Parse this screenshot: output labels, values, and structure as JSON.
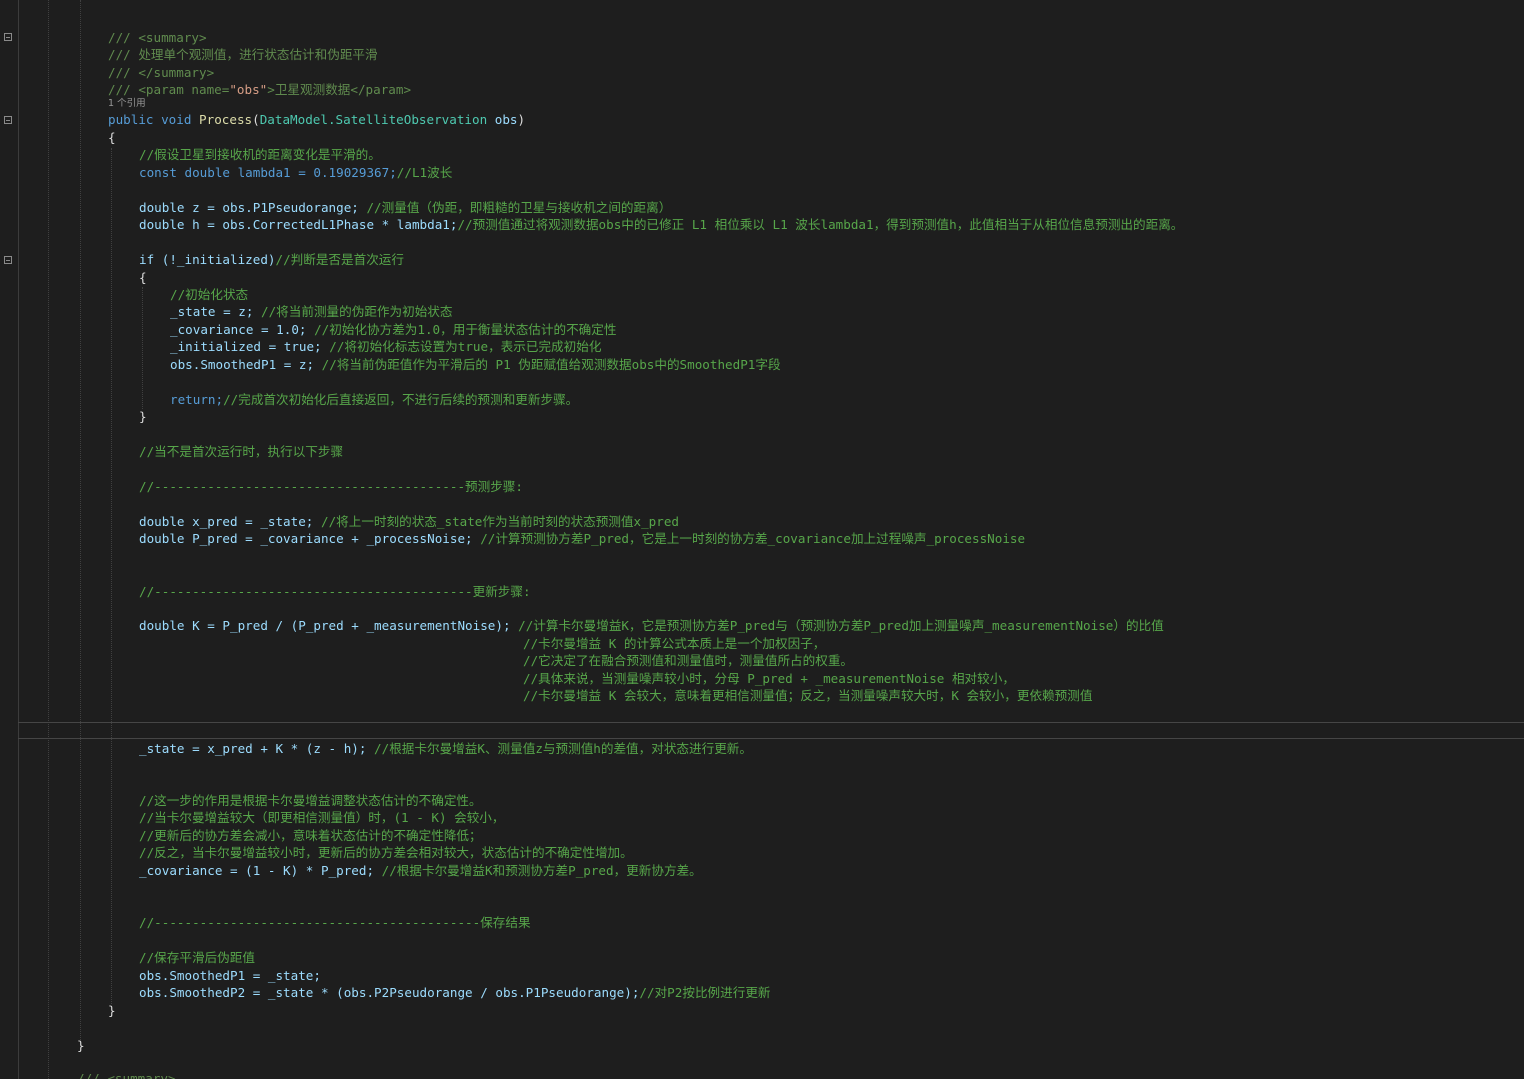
{
  "editor": {
    "lines": {
      "doc_summary_open": "/// <summary>",
      "doc_desc": "/// 处理单个观测值，进行状态估计和伪距平滑",
      "doc_summary_close": "/// </summary>",
      "doc_param_prefix": "/// <param name=",
      "doc_param_name": "\"obs\"",
      "doc_param_text": ">卫星观测数据</param>",
      "ref_count": "1 个引用",
      "sig_public": "public",
      "sig_void": "void",
      "sig_name": "Process",
      "sig_type": "DataModel.SatelliteObservation",
      "sig_param": "obs",
      "l_brace_open": "{",
      "c_assume": "//假设卫星到接收机的距离变化是平滑的。",
      "const_decl": "const double lambda1 = 0.19029367;",
      "const_comment": "//L1波长",
      "z_decl": "double z = obs.P1Pseudorange; ",
      "z_comment": "//测量值（伪距，即粗糙的卫星与接收机之间的距离）",
      "h_decl": "double h = obs.CorrectedL1Phase * lambda1;",
      "h_comment": "//预测值通过将观测数据obs中的已修正 L1 相位乘以 L1 波长lambda1，得到预测值h，此值相当于从相位信息预测出的距离。",
      "if_code": "if (!_initialized)",
      "if_comment": "//判断是否是首次运行",
      "if_brace_open": "{",
      "init_comment": "//初始化状态",
      "state_code": "_state = z; ",
      "state_comment": "//将当前测量的伪距作为初始状态",
      "cov_code": "_covariance = 1.0; ",
      "cov_comment": "//初始化协方差为1.0，用于衡量状态估计的不确定性",
      "init_code": "_initialized = true; ",
      "init_flag_comment": "//将初始化标志设置为true，表示已完成初始化",
      "smooth_code": "obs.SmoothedP1 = z; ",
      "smooth_comment": "//将当前伪距值作为平滑后的 P1 伪距赋值给观测数据obs中的SmoothedP1字段",
      "return_code": "return;",
      "return_comment": "//完成首次初始化后直接返回，不进行后续的预测和更新步骤。",
      "if_brace_close": "}",
      "not_first_comment": "//当不是首次运行时，执行以下步骤",
      "predict_sep": "//-----------------------------------------预测步骤:",
      "xpred_code": "double x_pred = _state; ",
      "xpred_comment": "//将上一时刻的状态_state作为当前时刻的状态预测值x_pred",
      "ppred_code": "double P_pred = _covariance + _processNoise; ",
      "ppred_comment": "//计算预测协方差P_pred，它是上一时刻的协方差_covariance加上过程噪声_processNoise",
      "update_sep": "//------------------------------------------更新步骤:",
      "k_code": "double K = P_pred / (P_pred + _measurementNoise); ",
      "k_comment1": "//计算卡尔曼增益K，它是预测协方差P_pred与（预测协方差P_pred加上测量噪声_measurementNoise）的比值",
      "k_comment2": "//卡尔曼增益 K 的计算公式本质上是一个加权因子，",
      "k_comment3": "//它决定了在融合预测值和测量值时，测量值所占的权重。",
      "k_comment4": "//具体来说，当测量噪声较小时，分母 P_pred + _measurementNoise 相对较小，",
      "k_comment5": "//卡尔曼增益 K 会较大，意味着更相信测量值；反之，当测量噪声较大时，K 会较小，更依赖预测值",
      "state_update_code": "_state = x_pred + K * (z - h); ",
      "state_update_comment": "//根据卡尔曼增益K、测量值z与预测值h的差值，对状态进行更新。",
      "cov_c1": "//这一步的作用是根据卡尔曼增益调整状态估计的不确定性。",
      "cov_c2": "//当卡尔曼增益较大（即更相信测量值）时，(1 - K) 会较小，",
      "cov_c3": "//更新后的协方差会减小，意味着状态估计的不确定性降低；",
      "cov_c4": "//反之，当卡尔曼增益较小时，更新后的协方差会相对较大，状态估计的不确定性增加。",
      "cov_update_code": "_covariance = (1 - K) * P_pred; ",
      "cov_update_comment": "//根据卡尔曼增益K和预测协方差P_pred，更新协方差。",
      "save_sep": "//-------------------------------------------保存结果",
      "save_comment": "//保存平滑后伪距值",
      "save_p1": "obs.SmoothedP1 = _state;",
      "save_p2_code": "obs.SmoothedP2 = _state * (obs.P2Pseudorange / obs.P1Pseudorange);",
      "save_p2_comment": "//对P2按比例进行更新",
      "method_close": "}",
      "class_close": "}",
      "next_doc": "/// <summary>"
    }
  }
}
